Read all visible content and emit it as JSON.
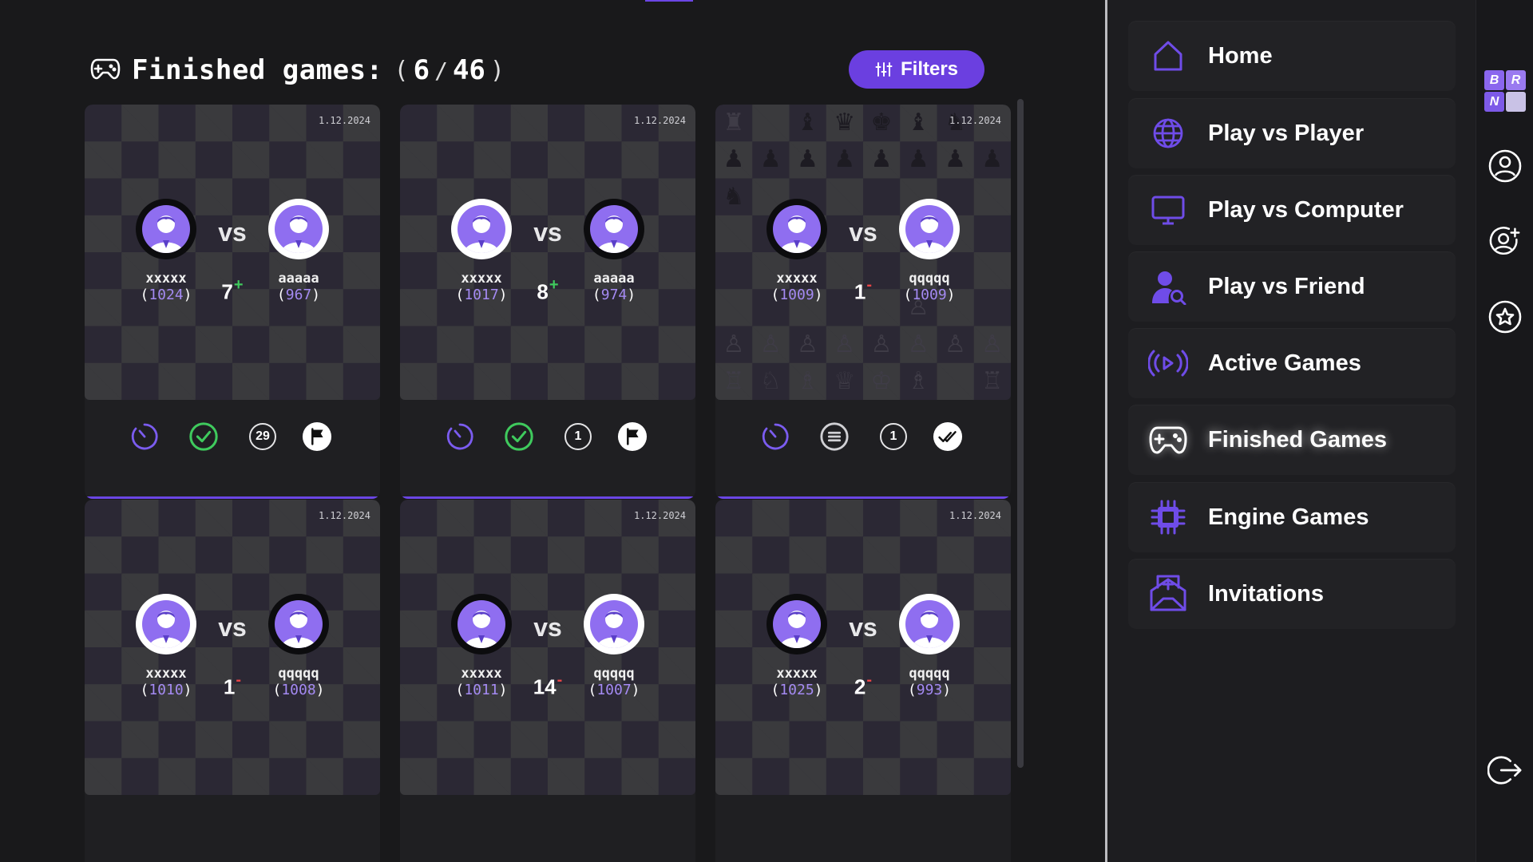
{
  "header": {
    "title": "Finished games:",
    "count_shown": "6",
    "count_separator": "/",
    "count_total": "46",
    "paren_open": "(",
    "paren_close": ")",
    "filters_label": "Filters"
  },
  "games": [
    {
      "date": "1.12.2024",
      "white": {
        "name": "xxxxx",
        "rating": "1024"
      },
      "black": {
        "name": "aaaaa",
        "rating": "967"
      },
      "moves": "7",
      "delta": "+",
      "result_icon": "check-circle-icon",
      "result_color": "#3fca5d",
      "count_badge": "29",
      "end_icon": "flag-icon",
      "left_avatar_style": "dark",
      "right_avatar_style": "light",
      "pieces": false
    },
    {
      "date": "1.12.2024",
      "white": {
        "name": "xxxxx",
        "rating": "1017"
      },
      "black": {
        "name": "aaaaa",
        "rating": "974"
      },
      "moves": "8",
      "delta": "+",
      "result_icon": "check-circle-icon",
      "result_color": "#3fca5d",
      "count_badge": "1",
      "end_icon": "flag-icon",
      "left_avatar_style": "light",
      "right_avatar_style": "dark",
      "pieces": false
    },
    {
      "date": "1.12.2024",
      "white": {
        "name": "xxxxx",
        "rating": "1009"
      },
      "black": {
        "name": "qqqqq",
        "rating": "1009"
      },
      "moves": "1",
      "delta": "-",
      "result_icon": "draw-icon",
      "result_color": "#d0d0d4",
      "count_badge": "1",
      "end_icon": "double-check-icon",
      "left_avatar_style": "dark",
      "right_avatar_style": "light",
      "pieces": true
    },
    {
      "date": "1.12.2024",
      "white": {
        "name": "xxxxx",
        "rating": "1010"
      },
      "black": {
        "name": "qqqqq",
        "rating": "1008"
      },
      "moves": "1",
      "delta": "-",
      "left_avatar_style": "light",
      "right_avatar_style": "dark",
      "pieces": false
    },
    {
      "date": "1.12.2024",
      "white": {
        "name": "xxxxx",
        "rating": "1011"
      },
      "black": {
        "name": "qqqqq",
        "rating": "1007"
      },
      "moves": "14",
      "delta": "-",
      "left_avatar_style": "dark",
      "right_avatar_style": "light",
      "pieces": false
    },
    {
      "date": "1.12.2024",
      "white": {
        "name": "xxxxx",
        "rating": "1025"
      },
      "black": {
        "name": "qqqqq",
        "rating": "993"
      },
      "moves": "2",
      "delta": "-",
      "left_avatar_style": "dark",
      "right_avatar_style": "light",
      "pieces": false
    }
  ],
  "vs_label": "vs",
  "nav": {
    "items": [
      {
        "label": "Home",
        "icon": "home-icon"
      },
      {
        "label": "Play vs Player",
        "icon": "globe-icon"
      },
      {
        "label": "Play vs Computer",
        "icon": "monitor-icon"
      },
      {
        "label": "Play vs Friend",
        "icon": "user-search-icon"
      },
      {
        "label": "Active Games",
        "icon": "broadcast-icon"
      },
      {
        "label": "Finished Games",
        "icon": "gamepad-icon",
        "active": true
      },
      {
        "label": "Engine Games",
        "icon": "chip-icon"
      },
      {
        "label": "Invitations",
        "icon": "envelope-plus-icon"
      }
    ]
  },
  "rail": {
    "logo_letters": [
      "B",
      "R",
      "N",
      ""
    ],
    "icons": [
      "profile-icon",
      "add-friend-icon",
      "star-badge-icon",
      "logout-icon"
    ]
  },
  "colors": {
    "accent": "#6b46e5",
    "avatar": "#8f6ef0",
    "rating": "#a48af2",
    "win": "#3fca5d",
    "loss": "#e84545"
  }
}
